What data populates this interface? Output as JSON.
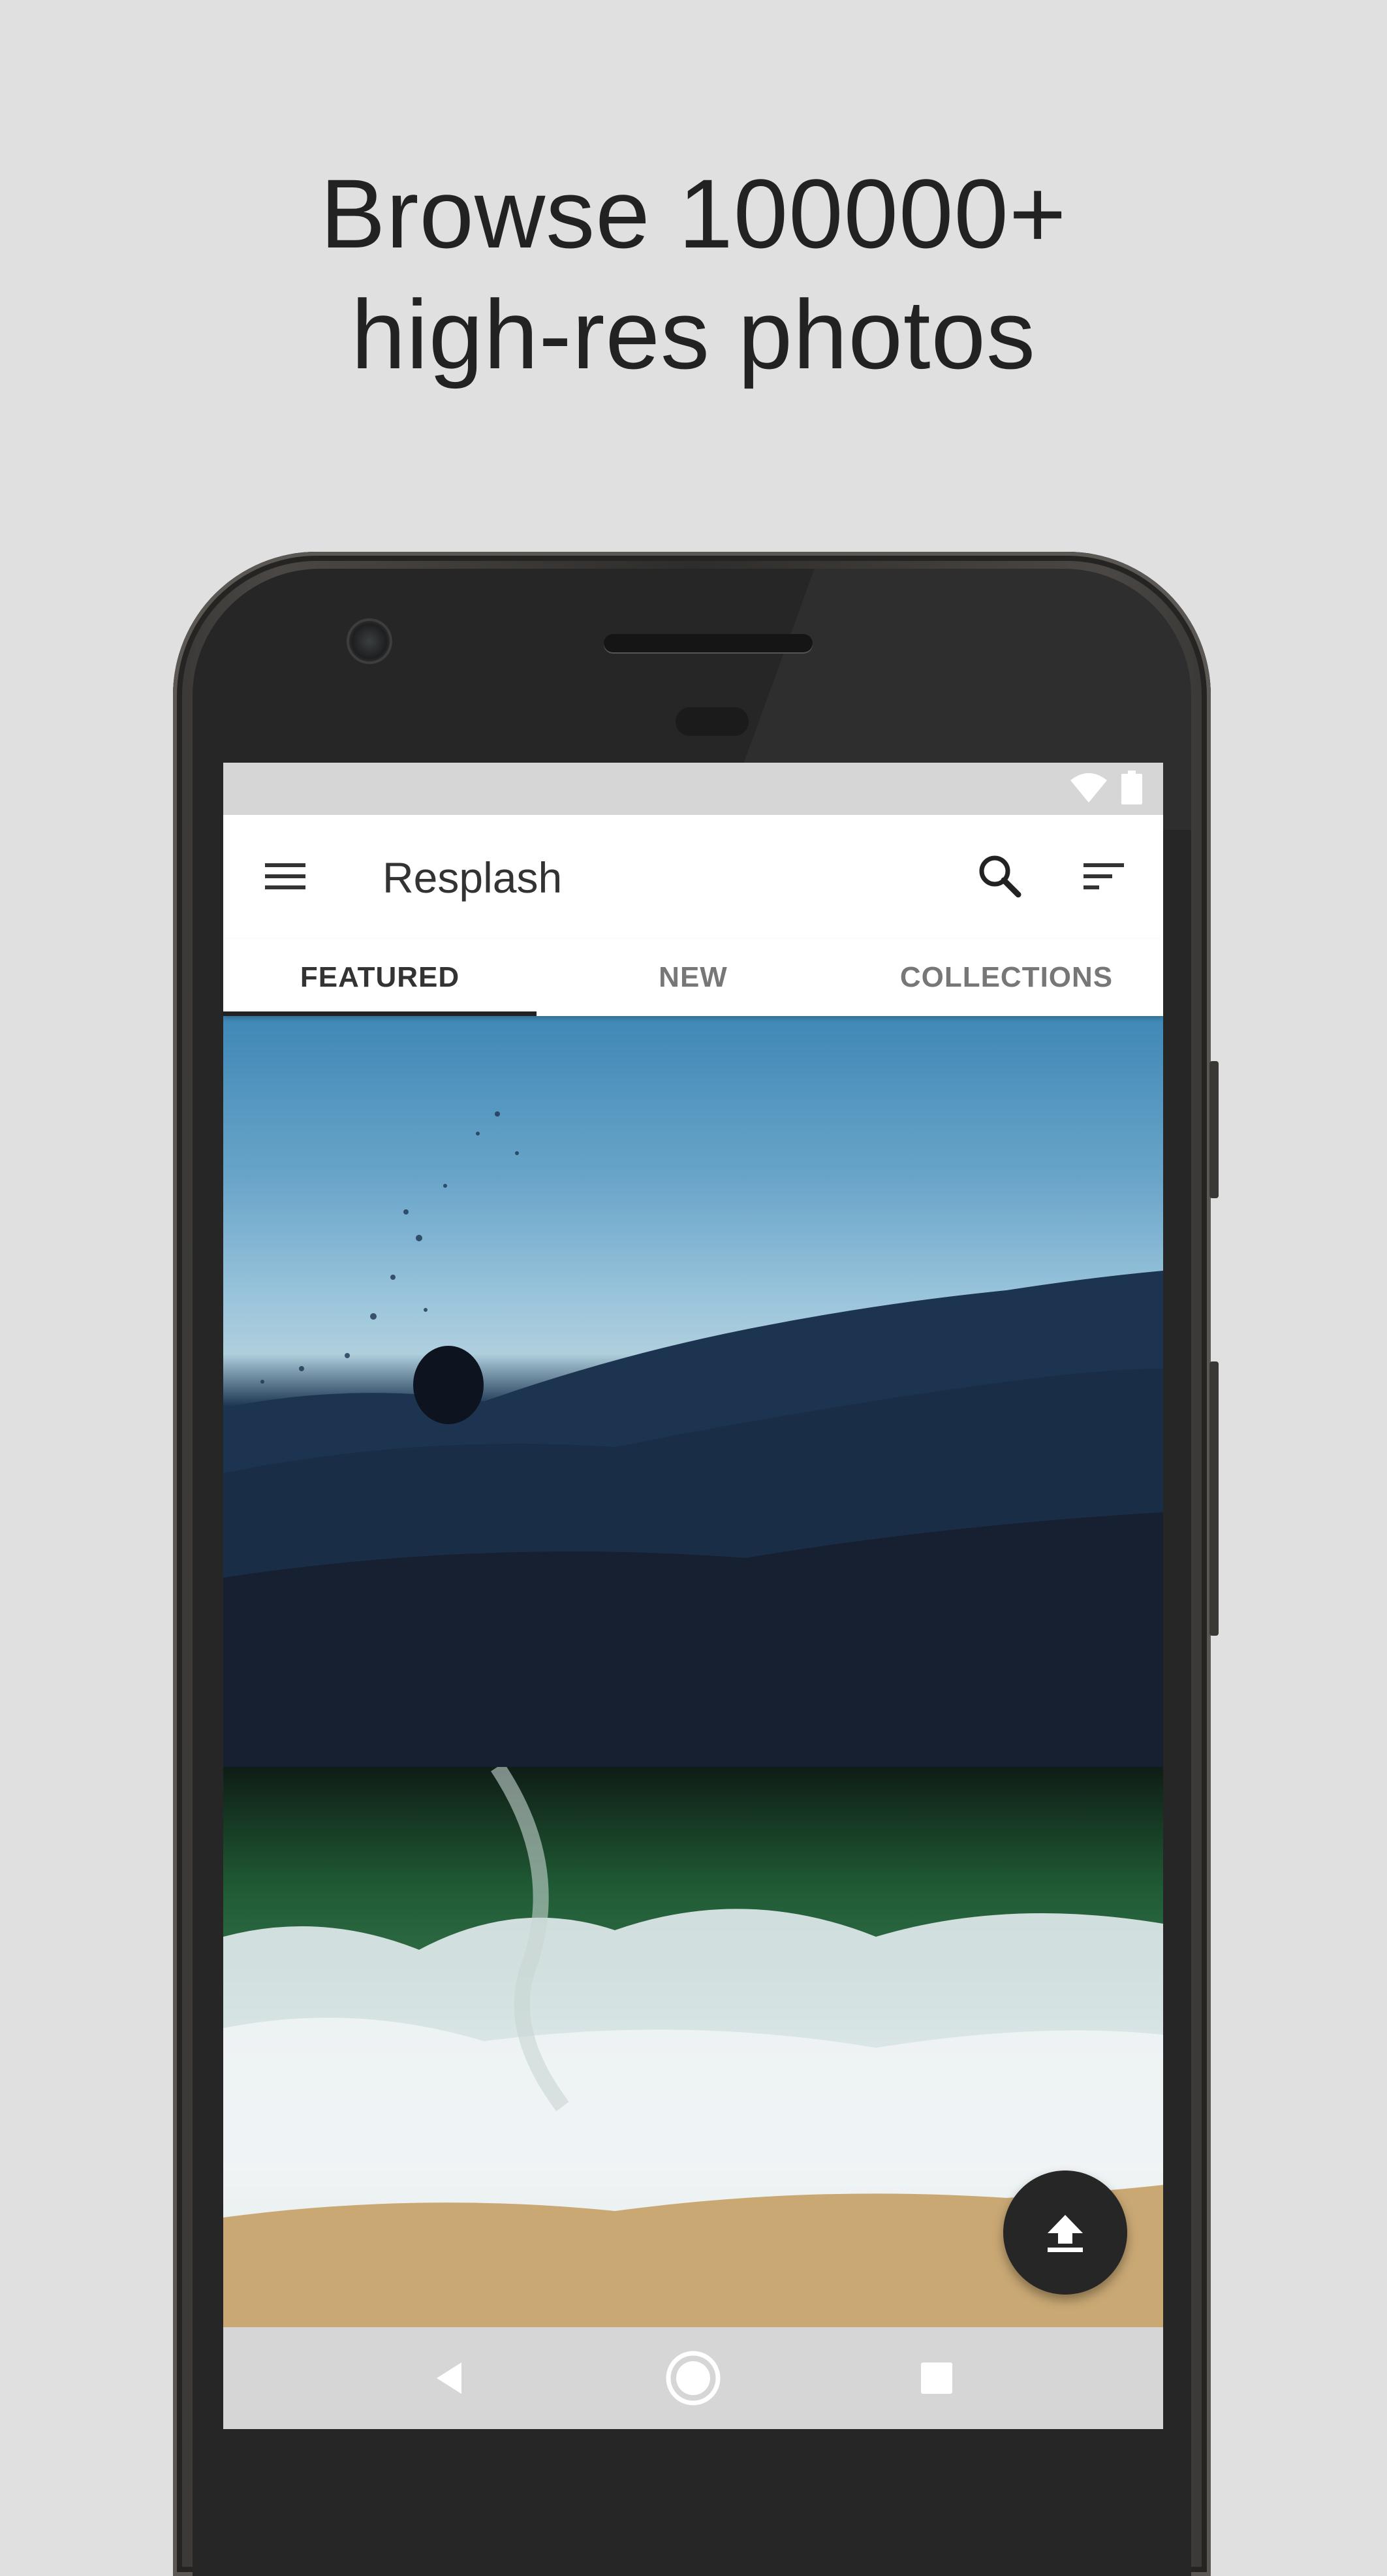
{
  "headline": {
    "line1": "Browse 100000+",
    "line2": "high-res photos"
  },
  "app": {
    "title": "Resplash",
    "icons": {
      "menu": "hamburger-menu-icon",
      "search": "search-icon",
      "sort": "sort-icon",
      "upload": "upload-icon"
    }
  },
  "status_bar": {
    "icons": [
      "wifi-icon",
      "battery-icon"
    ]
  },
  "tabs": [
    {
      "label": "FEATURED",
      "active": true
    },
    {
      "label": "NEW",
      "active": false
    },
    {
      "label": "COLLECTIONS",
      "active": false
    }
  ],
  "photos": [
    {
      "name": "ocean-swimmer-photo"
    },
    {
      "name": "aerial-beach-waves-photo"
    }
  ],
  "nav_bar": {
    "buttons": [
      "back-icon",
      "home-icon",
      "recents-icon"
    ]
  },
  "colors": {
    "background": "#e0e0e0",
    "appbar": "#ffffff",
    "fab": "#262626",
    "active_tab_indicator": "#222222"
  }
}
